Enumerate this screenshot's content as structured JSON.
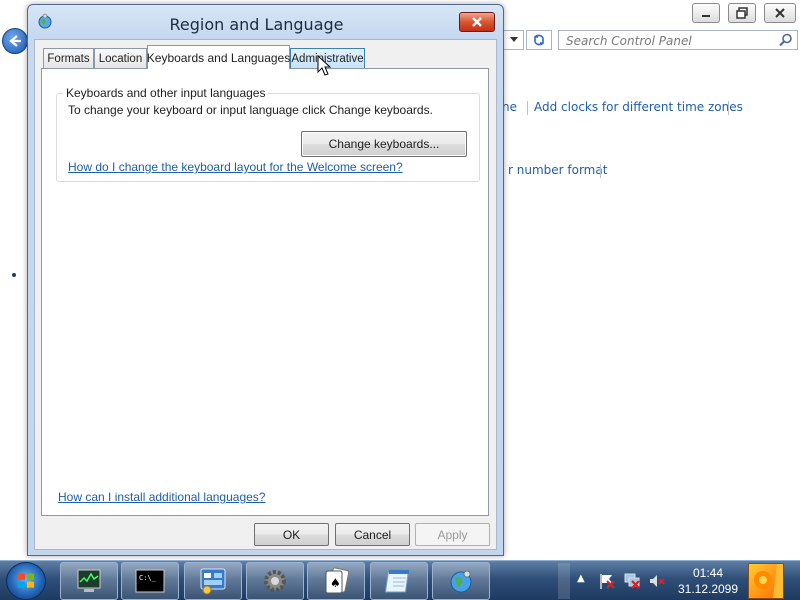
{
  "control_panel": {
    "search_placeholder": "Search Control Panel",
    "links": {
      "partial1": "ne",
      "clocks": "Add clocks for different time zones",
      "number_format": "r number format"
    }
  },
  "dialog": {
    "title": "Region and Language",
    "tabs": [
      {
        "label": "Formats"
      },
      {
        "label": "Location"
      },
      {
        "label": "Keyboards and Languages"
      },
      {
        "label": "Administrative"
      }
    ],
    "active_tab": "Keyboards and Languages",
    "group": {
      "label": "Keyboards and other input languages",
      "description": "To change your keyboard or input language click Change keyboards.",
      "button": "Change keyboards...",
      "link": "How do I change the keyboard layout for the Welcome screen?"
    },
    "install_link": "How can I install additional languages?",
    "buttons": {
      "ok": "OK",
      "cancel": "Cancel",
      "apply": "Apply"
    }
  },
  "taskbar": {
    "apps": [
      "task-manager",
      "command-prompt",
      "control-panel",
      "settings-gear",
      "solitaire",
      "notepad",
      "network-globe"
    ],
    "clock_time": "01:44",
    "clock_date": "31.12.2099"
  },
  "colors": {
    "link": "#1e5fa8",
    "title_bar": "#c6d9f0",
    "taskbar": "#2f4f78",
    "close_button": "#d9552f"
  }
}
